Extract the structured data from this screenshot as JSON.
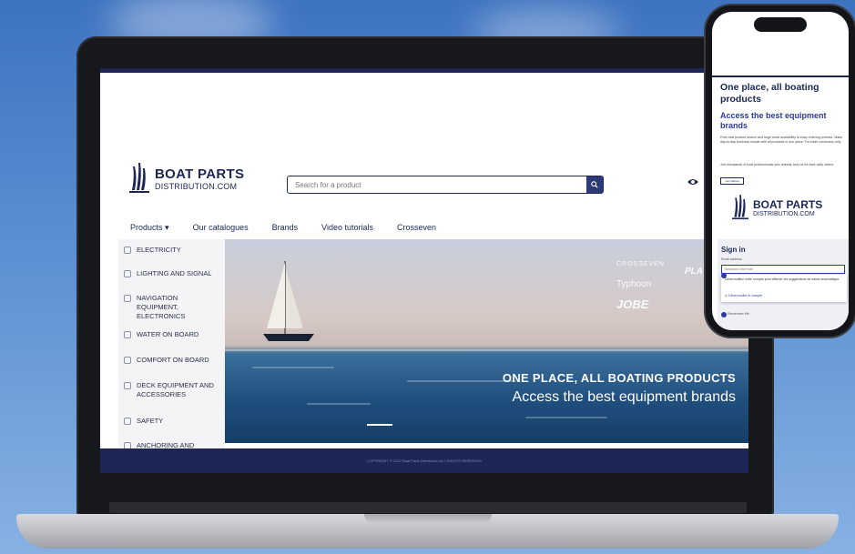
{
  "website": {
    "logo": {
      "line1": "BOAT PARTS",
      "line2": "DISTRIBUTION.COM"
    },
    "search": {
      "placeholder": "Search for a product"
    },
    "nav": {
      "products": "Products",
      "catalogues": "Our catalogues",
      "brands": "Brands",
      "video_tutorials": "Video tutorials",
      "crosseven": "Crosseven"
    },
    "categories": [
      {
        "label": "ELECTRICITY",
        "icon": "lightning-icon"
      },
      {
        "label": "LIGHTING AND SIGNAL",
        "icon": "bulb-icon"
      },
      {
        "label": "NAVIGATION EQUIPMENT, ELECTRONICS",
        "icon": "antenna-icon"
      },
      {
        "label": "WATER ON BOARD",
        "icon": "drop-icon"
      },
      {
        "label": "COMFORT ON BOARD",
        "icon": "comfort-icon"
      },
      {
        "label": "DECK EQUIPMENT AND ACCESSORIES",
        "icon": "deck-icon"
      },
      {
        "label": "SAFETY",
        "icon": "lifebuoy-icon"
      },
      {
        "label": "ANCHORING AND",
        "icon": "anchor-icon"
      }
    ],
    "hero": {
      "title": "ONE PLACE, ALL BOATING PRODUCTS",
      "subtitle": "Access the best equipment brands",
      "brands": [
        "CROSSEVEN",
        "Typhoon",
        "JOBE",
        "PLA"
      ]
    },
    "footer": {
      "text": "COPYRIGHT © 2022 Boat Parts Distribution ALL RIGHTS RESERVED"
    }
  },
  "phone": {
    "heading": "One place, all boating products",
    "subheading": "Access the best equipment brands",
    "paragraph1": "From fast product search and large stock availability to easy ordering process. Make day-to-day business simple with all products in one place. For trade customers only.",
    "paragraph2": "Join thousands of boat professionals who already trust us for their daily orders.",
    "button": "Get started",
    "logo": {
      "line1": "BOAT PARTS",
      "line2": "DISTRIBUTION.COM"
    },
    "signin_title": "Sign in",
    "email_label": "Email address",
    "email_placeholder": "Saisissez votre mail",
    "autofill_text": "Déverrouillez votre compte pour afficher les suggestions de saisie automatique",
    "autofill_action": "Déverrouiller le compte",
    "remember": "Remember Me"
  },
  "colors": {
    "brand_navy": "#1d2654",
    "accent_blue": "#2c3aa0"
  }
}
